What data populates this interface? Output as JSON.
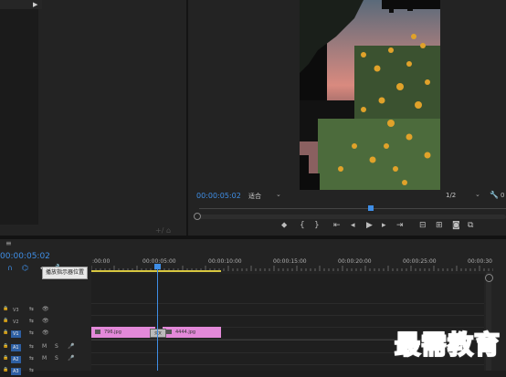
{
  "source_panel": {
    "collapse_icon": "triangle-right-icon",
    "footer_icons": [
      "add-icon",
      "export-icon"
    ]
  },
  "program_monitor": {
    "timecode": "00:00:05:02",
    "fit_label": "适合",
    "resolution_label": "1/2",
    "settings_icon": "wrench-icon",
    "right_label": "0",
    "transport_icons": [
      "marker-icon",
      "in-point-icon",
      "out-point-icon",
      "go-to-in-icon",
      "step-back-icon",
      "play-icon",
      "step-forward-icon",
      "go-to-out-icon",
      "lift-icon",
      "extract-icon",
      "export-frame-icon",
      "comparison-icon"
    ]
  },
  "timeline": {
    "menu_icon": "hamburger-icon",
    "timecode": "00:00:05:02",
    "ruler_labels": [
      ":00:00",
      "00:00:05:00",
      "00:00:10:00",
      "00:00:15:00",
      "00:00:20:00",
      "00:00:25:00",
      "00:00:30"
    ],
    "tooltip": "播放指示器位置",
    "tracks": [
      {
        "name": "V3",
        "selected": false
      },
      {
        "name": "V2",
        "selected": false
      },
      {
        "name": "V1",
        "selected": true
      },
      {
        "name": "A1",
        "selected": true
      },
      {
        "name": "A2",
        "selected": true
      },
      {
        "name": "A3",
        "selected": true
      }
    ],
    "audio_buttons": [
      "M",
      "S"
    ],
    "clips": [
      {
        "label": "796.jpg"
      },
      {
        "label": "4444.jpg"
      }
    ],
    "transition_label": "交叉"
  },
  "watermark": "最需教育"
}
